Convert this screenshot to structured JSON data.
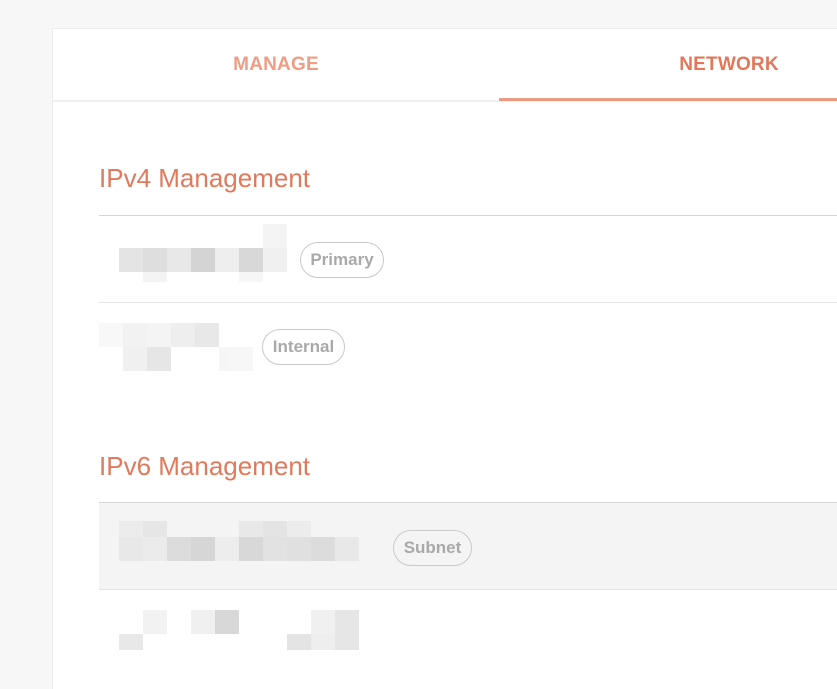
{
  "tabs": {
    "manage_label": "MANAGE",
    "network_label": "NETWORK"
  },
  "ipv4": {
    "title": "IPv4 Management",
    "entries": [
      {
        "badge": "Primary"
      },
      {
        "badge": "Internal"
      }
    ]
  },
  "ipv6": {
    "title": "IPv6 Management",
    "entries": [
      {
        "badge": "Subnet"
      },
      {
        "badge": ""
      }
    ]
  },
  "colors": {
    "accent": "#e2775a",
    "accent_light": "#ef9d85",
    "badge_text": "#a9a9a9",
    "badge_border": "#c9c9c9"
  }
}
